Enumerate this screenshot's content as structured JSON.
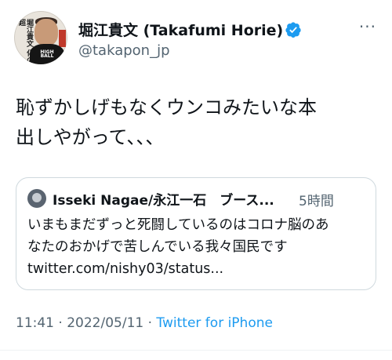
{
  "author": {
    "display_name": "堀江貴文 (Takafumi Horie)",
    "handle": "@takapon_jp",
    "verified": true,
    "avatar_icon": "profile-photo-avatar",
    "avatar_cover_text": "堀江貴文 化の超",
    "avatar_shirt_text": "HIGH BALL"
  },
  "more_icon": "more-dots-icon",
  "tweet": {
    "text_line1": "恥ずかしげもなくウンコみたいな本",
    "text_line2": "出しやがって、、、"
  },
  "quote": {
    "name": "Isseki Nagae/永江一石　ブース...",
    "time": "5時間",
    "line1": "いまもまだずっと死闘しているのはコロナ脳のあ",
    "line2": "なたのおかげで苦しんでいる我々国民です",
    "line3": "twitter.com/nishy03/status..."
  },
  "meta": {
    "time": "11:41",
    "date": "2022/05/11",
    "separator": " · ",
    "source": "Twitter for iPhone"
  },
  "colors": {
    "text": "#0f1419",
    "secondary": "#536471",
    "link": "#1d9bf0",
    "verified": "#1d9bf0",
    "border": "#cfd9de"
  }
}
